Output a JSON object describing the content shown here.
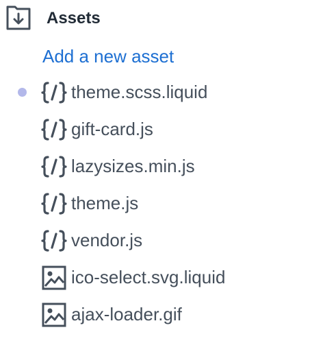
{
  "header": {
    "title": "Assets",
    "icon": "folder-download-icon"
  },
  "add_asset_label": "Add a new asset",
  "colors": {
    "link": "#1d6fd2",
    "text": "#454f5b",
    "title": "#212b36",
    "unsaved_dot": "#b3b8ea"
  },
  "assets": [
    {
      "name": "theme.scss.liquid",
      "icon": "code-icon",
      "modified": true
    },
    {
      "name": "gift-card.js",
      "icon": "code-icon",
      "modified": false
    },
    {
      "name": "lazysizes.min.js",
      "icon": "code-icon",
      "modified": false
    },
    {
      "name": "theme.js",
      "icon": "code-icon",
      "modified": false
    },
    {
      "name": "vendor.js",
      "icon": "code-icon",
      "modified": false
    },
    {
      "name": "ico-select.svg.liquid",
      "icon": "image-icon",
      "modified": false
    },
    {
      "name": "ajax-loader.gif",
      "icon": "image-icon",
      "modified": false
    }
  ]
}
